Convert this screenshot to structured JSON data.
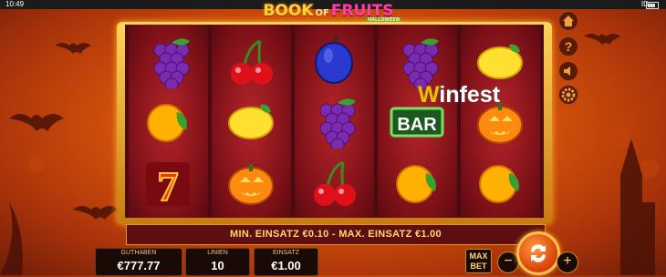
{
  "status_bar": {
    "time": "10:49",
    "id_label": "ID: -"
  },
  "logo": {
    "book": "BOOK",
    "of": "OF",
    "fruits": "FRUITS",
    "subtitle": "HALLOWEEN"
  },
  "reels": [
    [
      "grapes",
      "orange",
      "seven"
    ],
    [
      "cherries",
      "lemon",
      "pumpkin"
    ],
    [
      "plum",
      "grapes",
      "cherries"
    ],
    [
      "grapes",
      "bar",
      "orange"
    ],
    [
      "lemon",
      "pumpkin",
      "orange"
    ]
  ],
  "bar_symbol_text": "BAR",
  "bet_range_text": "MIN. EINSATZ €0.10 - MAX. EINSATZ €1.00",
  "footer": {
    "cash_label": "GUTHABEN",
    "cash_value": "€777.77",
    "lines_label": "LINIEN",
    "lines_value": "10",
    "bet_label": "EINSATZ",
    "bet_value": "€1.00",
    "max_bet_line1": "MAX",
    "max_bet_line2": "BET",
    "minus": "−",
    "plus": "+"
  },
  "side_icons": [
    "home-icon",
    "help-icon",
    "sound-icon",
    "settings-icon"
  ],
  "watermark": {
    "w": "W",
    "rest": "infest"
  }
}
